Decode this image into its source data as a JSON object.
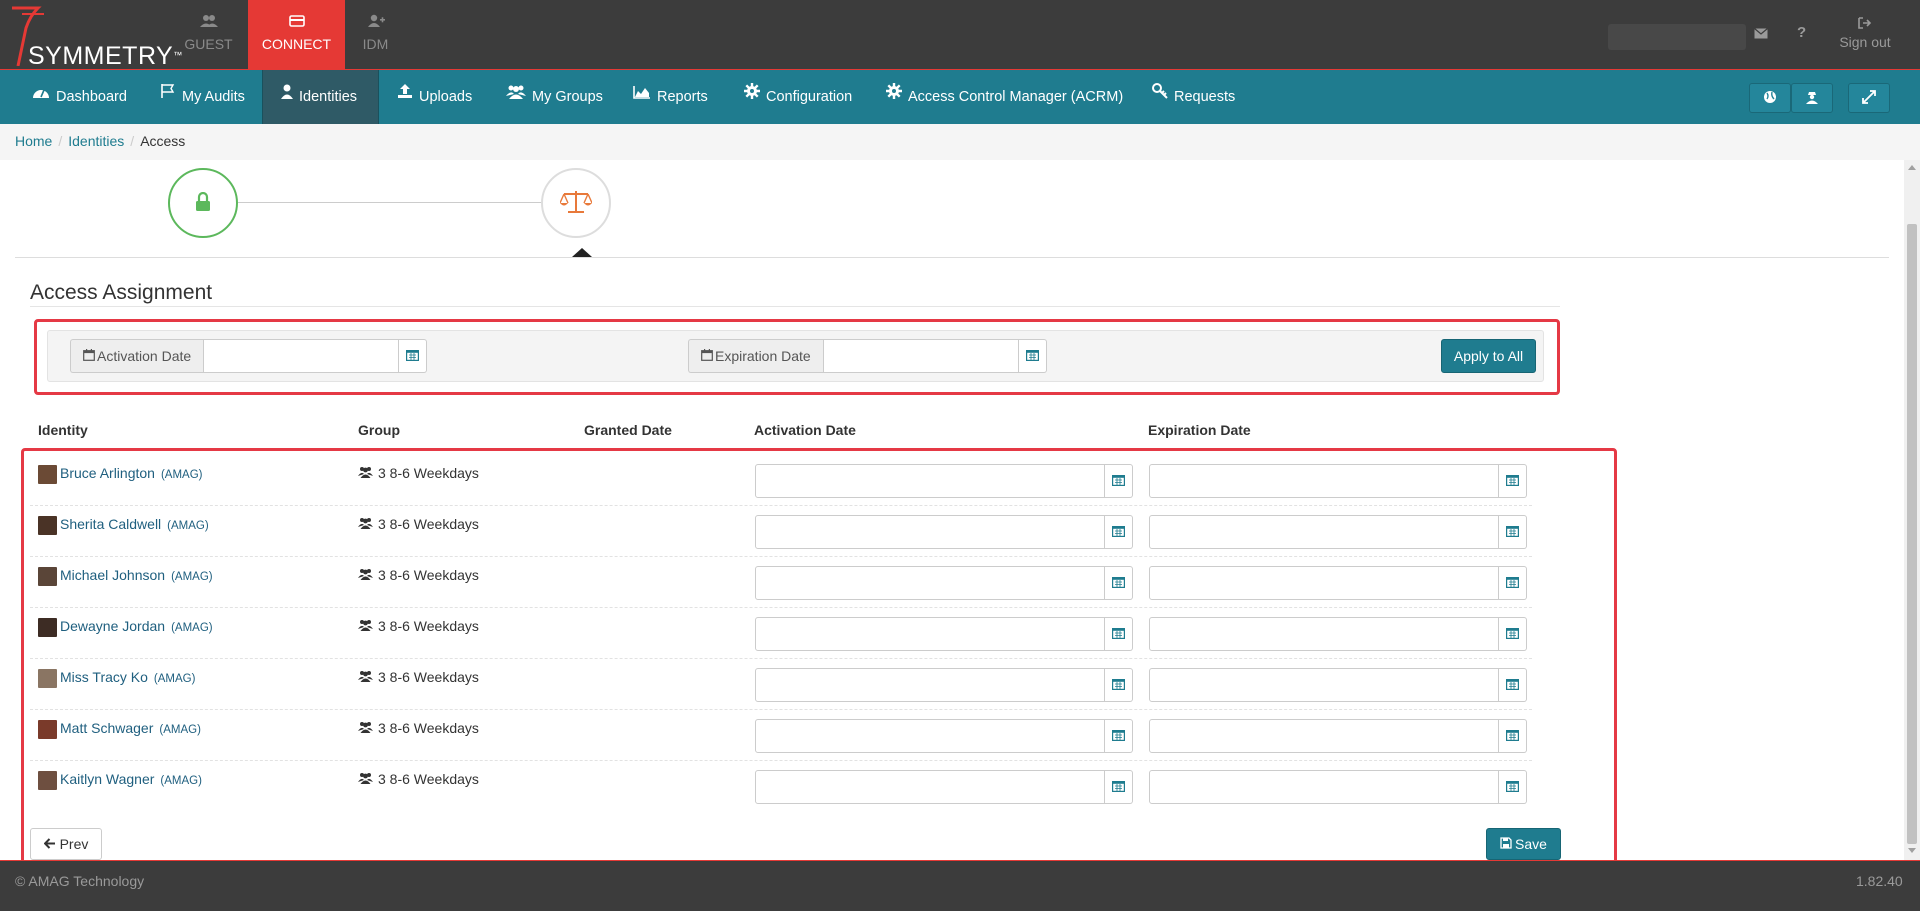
{
  "brand": {
    "logo_text": "SYMMETRY",
    "trademark": "™"
  },
  "top_tabs": [
    {
      "label": "GUEST",
      "icon": "users-icon"
    },
    {
      "label": "CONNECT",
      "icon": "card-icon",
      "active": true
    },
    {
      "label": "IDM",
      "icon": "user-plus-icon"
    }
  ],
  "top_right": {
    "mail_icon": "mail-icon",
    "help_icon": "question-icon",
    "sign_out": "Sign out"
  },
  "nav": {
    "items": [
      {
        "label": "Dashboard",
        "icon": "dashboard-icon"
      },
      {
        "label": "My Audits",
        "icon": "flag-icon"
      },
      {
        "label": "Identities",
        "icon": "user-icon",
        "active": true
      },
      {
        "label": "Uploads",
        "icon": "upload-icon"
      },
      {
        "label": "My Groups",
        "icon": "groups-icon"
      },
      {
        "label": "Reports",
        "icon": "area-chart-icon"
      },
      {
        "label": "Configuration",
        "icon": "gear-icon"
      },
      {
        "label": "Access Control Manager (ACRM)",
        "icon": "gear-icon"
      },
      {
        "label": "Requests",
        "icon": "key-icon"
      }
    ]
  },
  "breadcrumb": {
    "home": "Home",
    "identities": "Identities",
    "current": "Access",
    "separator": "/"
  },
  "wizard": {
    "steps": [
      {
        "icon": "lock-icon",
        "state": "complete"
      },
      {
        "icon": "balance-scale-icon",
        "state": "current"
      }
    ]
  },
  "section_title": "Access Assignment",
  "apply_panel": {
    "activation_label": "Activation Date",
    "activation_value": "",
    "expiration_label": "Expiration Date",
    "expiration_value": "",
    "apply_button": "Apply to All"
  },
  "table": {
    "headers": {
      "identity": "Identity",
      "group": "Group",
      "granted": "Granted Date",
      "activation": "Activation Date",
      "expiration": "Expiration Date"
    },
    "rows": [
      {
        "name": "Bruce Arlington",
        "org": "(AMAG)",
        "group": "3 8-6 Weekdays",
        "granted": "",
        "activation": "",
        "expiration": "",
        "avatar_color": "#6b4a35"
      },
      {
        "name": "Sherita Caldwell",
        "org": "(AMAG)",
        "group": "3 8-6 Weekdays",
        "granted": "",
        "activation": "",
        "expiration": "",
        "avatar_color": "#4a3326"
      },
      {
        "name": "Michael Johnson",
        "org": "(AMAG)",
        "group": "3 8-6 Weekdays",
        "granted": "",
        "activation": "",
        "expiration": "",
        "avatar_color": "#5a4538"
      },
      {
        "name": "Dewayne Jordan",
        "org": "(AMAG)",
        "group": "3 8-6 Weekdays",
        "granted": "",
        "activation": "",
        "expiration": "",
        "avatar_color": "#3d2c24"
      },
      {
        "name": "Miss Tracy Ko",
        "org": "(AMAG)",
        "group": "3 8-6 Weekdays",
        "granted": "",
        "activation": "",
        "expiration": "",
        "avatar_color": "#8a7563"
      },
      {
        "name": "Matt Schwager",
        "org": "(AMAG)",
        "group": "3 8-6 Weekdays",
        "granted": "",
        "activation": "",
        "expiration": "",
        "avatar_color": "#7a3a2a"
      },
      {
        "name": "Kaitlyn Wagner",
        "org": "(AMAG)",
        "group": "3 8-6 Weekdays",
        "granted": "",
        "activation": "",
        "expiration": "",
        "avatar_color": "#6e4f40"
      }
    ]
  },
  "buttons": {
    "prev": "Prev",
    "save": "Save"
  },
  "footer": {
    "copyright": "© AMAG Technology",
    "version": "1.82.40"
  },
  "colors": {
    "accent": "#1f7c8f",
    "brand_red": "#e53935",
    "topbar": "#3c3c3c",
    "highlight": "#e53945",
    "success": "#5cb85c",
    "orange": "#e8793a"
  }
}
